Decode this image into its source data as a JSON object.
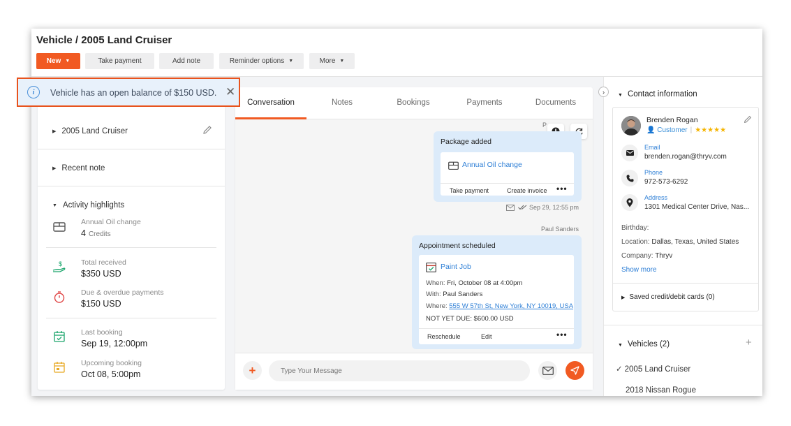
{
  "header": {
    "title": "Vehicle / 2005 Land Cruiser",
    "buttons": {
      "new": "New",
      "take_payment": "Take payment",
      "add_note": "Add note",
      "reminder_options": "Reminder options",
      "more": "More"
    }
  },
  "banner": {
    "icon": "info-icon",
    "text": "Vehicle has an open balance of $150 USD."
  },
  "left_panel": {
    "vehicle_name": "2005 Land Cruiser",
    "recent_note_label": "Recent note",
    "activity_highlights_label": "Activity highlights",
    "highlights": [
      {
        "icon": "package-icon",
        "label": "Annual Oil change",
        "value": "4",
        "sub": "Credits"
      },
      {
        "icon": "money-hand-icon",
        "label": "Total received",
        "value": "$350 USD"
      },
      {
        "icon": "stopwatch-icon",
        "label": "Due & overdue payments",
        "value": "$150 USD"
      },
      {
        "icon": "calendar-check-icon",
        "label": "Last booking",
        "value": "Sep 19, 12:00pm"
      },
      {
        "icon": "calendar-upcoming-icon",
        "label": "Upcoming booking",
        "value": "Oct 08, 5:00pm"
      }
    ]
  },
  "tabs": [
    "Conversation",
    "Notes",
    "Bookings",
    "Payments",
    "Documents"
  ],
  "conversation": {
    "clipped_sender": "P",
    "package_card": {
      "title": "Package added",
      "item": "Annual Oil change",
      "actions": [
        "Take payment",
        "Create invoice"
      ],
      "timestamp": "Sep 29, 12:55 pm"
    },
    "appointment_sender": "Paul Sanders",
    "appointment_card": {
      "title": "Appointment scheduled",
      "service": "Paint Job",
      "when_label": "When:",
      "when": "Fri, October 08 at 4:00pm",
      "with_label": "With:",
      "with": "Paul Sanders",
      "where_label": "Where:",
      "where": "555 W 57th St, New York, NY 10019, USA",
      "due": "NOT YET DUE: $600.00 USD",
      "actions": [
        "Reschedule",
        "Edit"
      ]
    },
    "composer_placeholder": "Type Your Message"
  },
  "contact": {
    "section_label": "Contact information",
    "name": "Brenden Rogan",
    "role": "Customer",
    "rating": 5,
    "stars": "★★★★★",
    "email_label": "Email",
    "email": "brenden.rogan@thryv.com",
    "phone_label": "Phone",
    "phone": "972-573-6292",
    "address_label": "Address",
    "address": "1301 Medical Center Drive, Nas...",
    "birthday_label": "Birthday:",
    "location_label": "Location:",
    "location": "Dallas, Texas, United States",
    "company_label": "Company:",
    "company": "Thryv",
    "show_more": "Show more",
    "saved_cards": "Saved credit/debit cards (0)"
  },
  "vehicles": {
    "label": "Vehicles (2)",
    "items": [
      "2005 Land Cruiser",
      "2018 Nissan Rogue"
    ]
  },
  "colors": {
    "accent": "#f15a22",
    "link": "#2e7fd6",
    "card_bg": "#dcebfa",
    "banner_bg": "#e8f1fb",
    "banner_border": "#e8531d",
    "star": "#f5b400"
  }
}
